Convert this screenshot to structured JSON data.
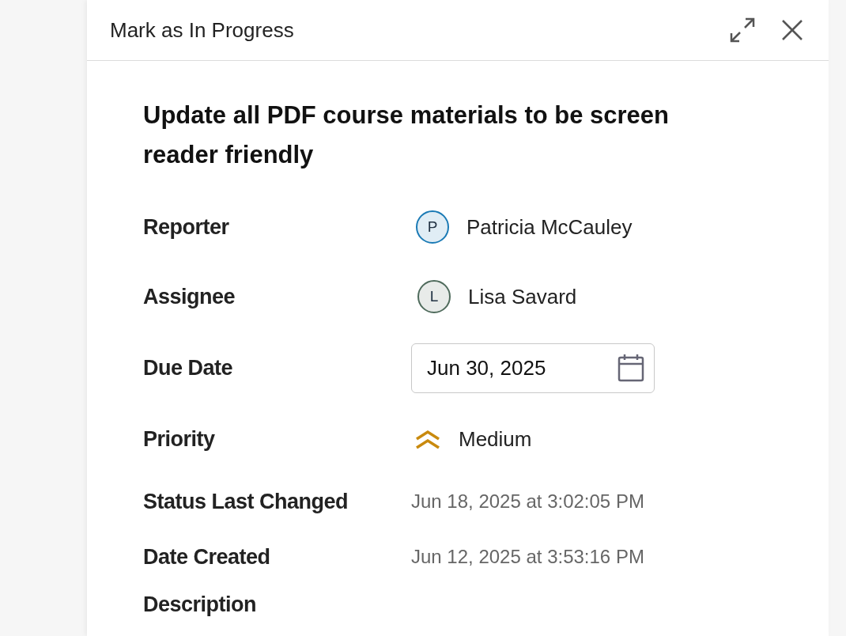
{
  "panel": {
    "title": "Mark as In Progress"
  },
  "task": {
    "title": "Update all PDF course materials to be screen reader friendly"
  },
  "fields": [
    {
      "label": "Reporter",
      "kind": "person",
      "initial": "P",
      "name": "Patricia McCauley",
      "color": "#1a7ab5"
    },
    {
      "label": "Assignee",
      "kind": "person",
      "initial": "L",
      "name": "Lisa Savard",
      "color": "#4f6b5c"
    },
    {
      "label": "Due Date",
      "kind": "date",
      "value": "Jun 30, 2025"
    },
    {
      "label": "Priority",
      "kind": "priority",
      "value": "Medium"
    },
    {
      "label": "Status Last Changed",
      "kind": "timestamp",
      "value": "Jun 18, 2025 at 3:02:05 PM"
    },
    {
      "label": "Date Created",
      "kind": "timestamp",
      "value": "Jun 12, 2025 at 3:53:16 PM"
    }
  ],
  "section": {
    "label": "Description"
  }
}
